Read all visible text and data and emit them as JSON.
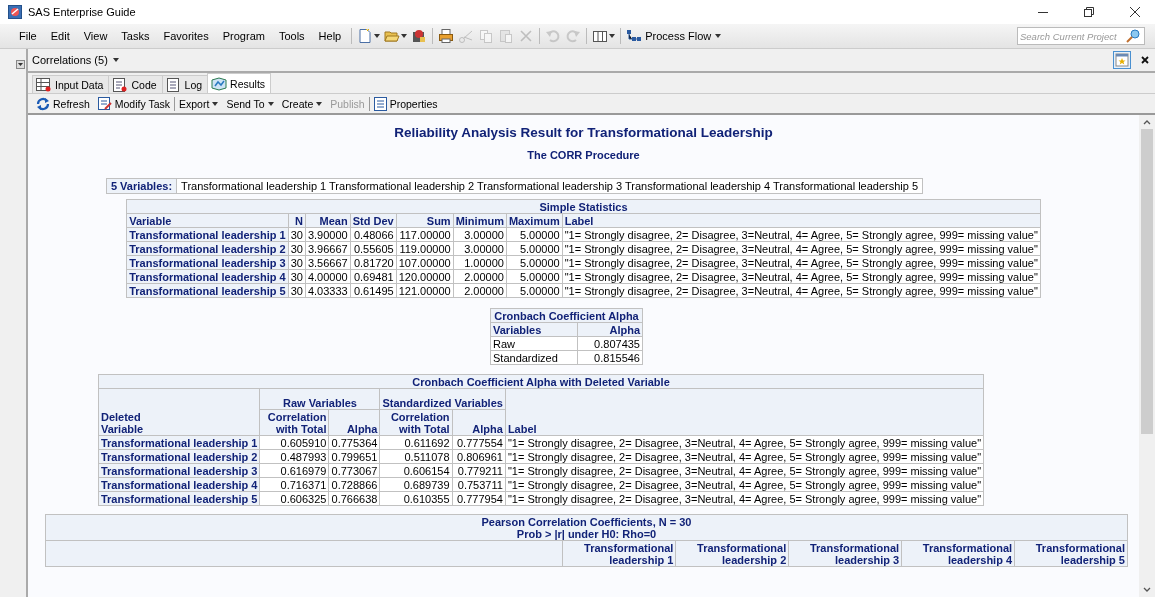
{
  "window": {
    "title": "SAS Enterprise Guide"
  },
  "menu": [
    "File",
    "Edit",
    "View",
    "Tasks",
    "Favorites",
    "Program",
    "Tools",
    "Help"
  ],
  "toolbar": [
    {
      "kind": "new",
      "dropdown": true,
      "disabled": false
    },
    {
      "kind": "open",
      "dropdown": true,
      "disabled": false
    },
    {
      "kind": "properties",
      "dropdown": false,
      "disabled": false
    },
    {
      "kind": "print",
      "dropdown": false,
      "disabled": false
    },
    {
      "kind": "cut",
      "dropdown": false,
      "disabled": true
    },
    {
      "kind": "copy",
      "dropdown": false,
      "disabled": true
    },
    {
      "kind": "paste",
      "dropdown": false,
      "disabled": true
    },
    {
      "kind": "delete",
      "dropdown": false,
      "disabled": true
    },
    {
      "kind": "undo",
      "dropdown": false,
      "disabled": true
    },
    {
      "kind": "redo",
      "dropdown": false,
      "disabled": true
    },
    {
      "kind": "layout",
      "dropdown": true,
      "disabled": false
    }
  ],
  "process_flow": "Process Flow",
  "search": {
    "placeholder": "Search Current Project"
  },
  "document_tab": "Correlations (5)",
  "tabs": [
    {
      "label": "Input Data",
      "kind": "data",
      "selected": false
    },
    {
      "label": "Code",
      "kind": "code",
      "selected": false
    },
    {
      "label": "Log",
      "kind": "log",
      "selected": false
    },
    {
      "label": "Results",
      "kind": "results",
      "selected": true
    }
  ],
  "actions": [
    {
      "label": "Refresh",
      "kind": "refresh",
      "dropdown": false,
      "disabled": false
    },
    {
      "label": "Modify Task",
      "kind": "modify",
      "dropdown": false,
      "disabled": false
    },
    {
      "kind": "separator"
    },
    {
      "label": "Export",
      "kind": "menu",
      "dropdown": true,
      "disabled": false
    },
    {
      "label": "Send To",
      "kind": "menu",
      "dropdown": true,
      "disabled": false
    },
    {
      "label": "Create",
      "kind": "menu",
      "dropdown": true,
      "disabled": false
    },
    {
      "label": "Publish",
      "kind": "menu",
      "dropdown": false,
      "disabled": true
    },
    {
      "kind": "separator"
    },
    {
      "label": "Properties",
      "kind": "properties",
      "dropdown": false,
      "disabled": false
    }
  ],
  "report": {
    "title": "Reliability Analysis Result for Transformational Leadership",
    "subtitle": "The CORR Procedure",
    "variables": {
      "label": "5 Variables:",
      "value": "Transformational leadership 1 Transformational leadership 2 Transformational leadership 3 Transformational leadership 4 Transformational leadership 5"
    },
    "simple_statistics": {
      "title": "Simple Statistics",
      "columns": [
        "Variable",
        "N",
        "Mean",
        "Std Dev",
        "Sum",
        "Minimum",
        "Maximum",
        "Label"
      ],
      "rows": [
        [
          "Transformational leadership 1",
          "30",
          "3.90000",
          "0.48066",
          "117.00000",
          "3.00000",
          "5.00000",
          "\"1= Strongly disagree, 2= Disagree, 3=Neutral, 4= Agree, 5= Strongly agree, 999= missing value\""
        ],
        [
          "Transformational leadership 2",
          "30",
          "3.96667",
          "0.55605",
          "119.00000",
          "3.00000",
          "5.00000",
          "\"1= Strongly disagree, 2= Disagree, 3=Neutral, 4= Agree, 5= Strongly agree, 999= missing value\""
        ],
        [
          "Transformational leadership 3",
          "30",
          "3.56667",
          "0.81720",
          "107.00000",
          "1.00000",
          "5.00000",
          "\"1= Strongly disagree, 2= Disagree, 3=Neutral, 4= Agree, 5= Strongly agree, 999= missing value\""
        ],
        [
          "Transformational leadership 4",
          "30",
          "4.00000",
          "0.69481",
          "120.00000",
          "2.00000",
          "5.00000",
          "\"1= Strongly disagree, 2= Disagree, 3=Neutral, 4= Agree, 5= Strongly agree, 999= missing value\""
        ],
        [
          "Transformational leadership 5",
          "30",
          "4.03333",
          "0.61495",
          "121.00000",
          "2.00000",
          "5.00000",
          "\"1= Strongly disagree, 2= Disagree, 3=Neutral, 4= Agree, 5= Strongly agree, 999= missing value\""
        ]
      ]
    },
    "cronbach": {
      "title": "Cronbach Coefficient Alpha",
      "columns": [
        "Variables",
        "Alpha"
      ],
      "rows": [
        [
          "Raw",
          "0.807435"
        ],
        [
          "Standardized",
          "0.815546"
        ]
      ]
    },
    "deleted": {
      "title": "Cronbach Coefficient Alpha with Deleted Variable",
      "groups": [
        "Raw Variables",
        "Standardized Variables"
      ],
      "columns": [
        "Deleted Variable",
        "Correlation with Total",
        "Alpha",
        "Correlation with Total",
        "Alpha",
        "Label"
      ],
      "rows": [
        [
          "Transformational leadership 1",
          "0.605910",
          "0.775364",
          "0.611692",
          "0.777554",
          "\"1= Strongly disagree, 2= Disagree, 3=Neutral, 4= Agree, 5= Strongly agree, 999= missing value\""
        ],
        [
          "Transformational leadership 2",
          "0.487993",
          "0.799651",
          "0.511078",
          "0.806961",
          "\"1= Strongly disagree, 2= Disagree, 3=Neutral, 4= Agree, 5= Strongly agree, 999= missing value\""
        ],
        [
          "Transformational leadership 3",
          "0.616979",
          "0.773067",
          "0.606154",
          "0.779211",
          "\"1= Strongly disagree, 2= Disagree, 3=Neutral, 4= Agree, 5= Strongly agree, 999= missing value\""
        ],
        [
          "Transformational leadership 4",
          "0.716371",
          "0.728866",
          "0.689739",
          "0.753711",
          "\"1= Strongly disagree, 2= Disagree, 3=Neutral, 4= Agree, 5= Strongly agree, 999= missing value\""
        ],
        [
          "Transformational leadership 5",
          "0.606325",
          "0.766638",
          "0.610355",
          "0.777954",
          "\"1= Strongly disagree, 2= Disagree, 3=Neutral, 4= Agree, 5= Strongly agree, 999= missing value\""
        ]
      ]
    },
    "pearson": {
      "title": "Pearson Correlation Coefficients, N = 30",
      "subtitle": "Prob > |r| under H0: Rho=0",
      "columns": [
        "Transformational leadership 1",
        "Transformational leadership 2",
        "Transformational leadership 3",
        "Transformational leadership 4",
        "Transformational leadership 5"
      ]
    }
  }
}
